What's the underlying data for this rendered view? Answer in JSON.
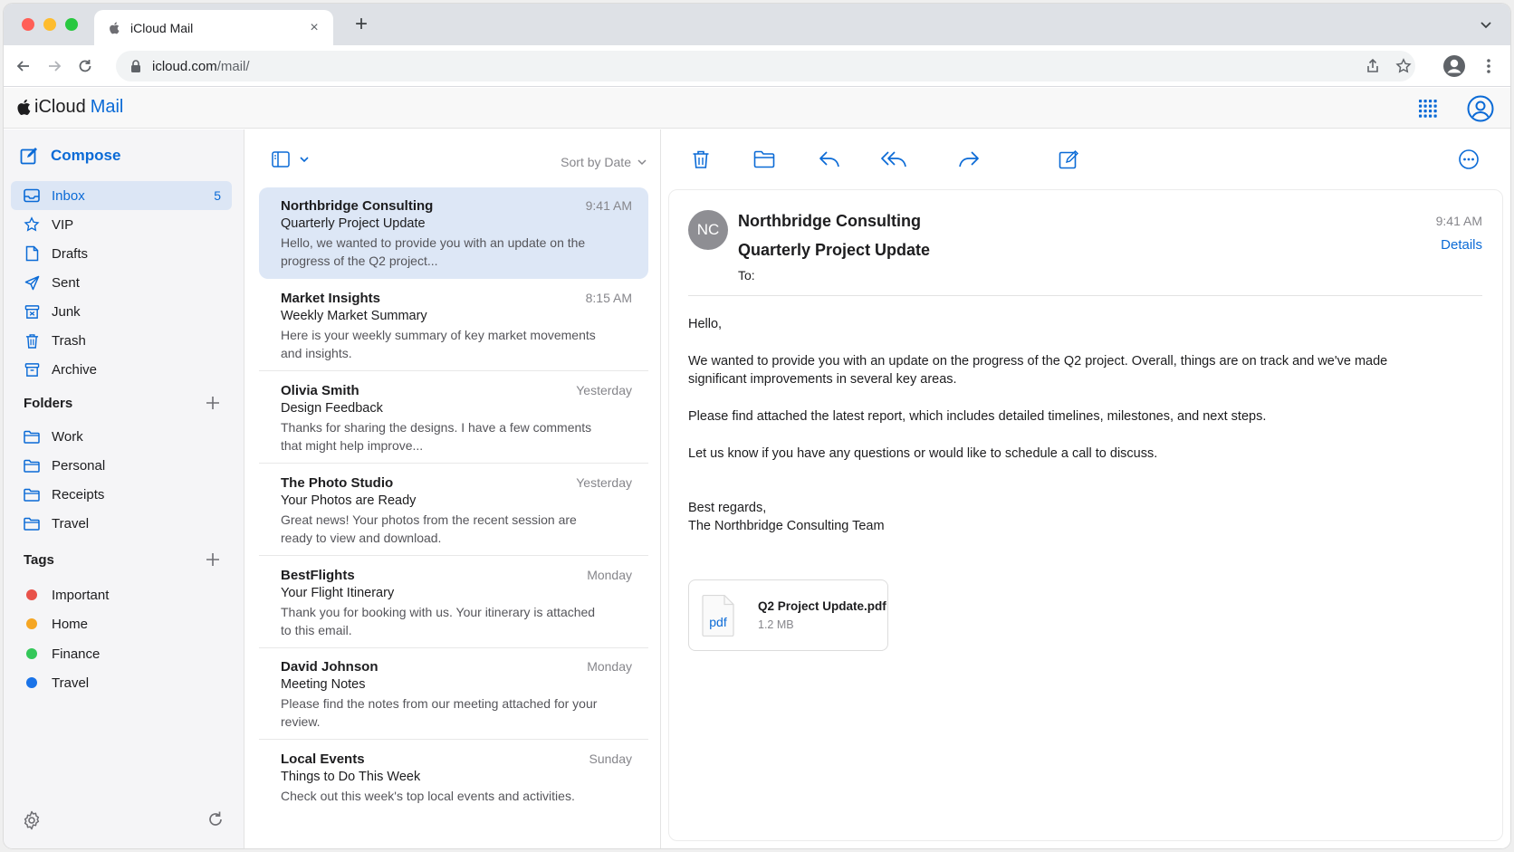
{
  "browser": {
    "tab_title": "iCloud Mail",
    "tab_close": "×",
    "new_tab": "+",
    "url_host": "icloud.com",
    "url_path": "/mail/"
  },
  "app": {
    "brand_icloud": "iCloud",
    "brand_mail": "Mail"
  },
  "sidebar": {
    "compose_label": "Compose",
    "mailboxes": [
      {
        "label": "Inbox",
        "count": "5",
        "icon": "inbox-icon"
      },
      {
        "label": "VIP",
        "icon": "star-icon"
      },
      {
        "label": "Drafts",
        "icon": "draft-icon"
      },
      {
        "label": "Sent",
        "icon": "sent-icon"
      },
      {
        "label": "Junk",
        "icon": "junk-icon"
      },
      {
        "label": "Trash",
        "icon": "trash-icon"
      },
      {
        "label": "Archive",
        "icon": "archive-icon"
      }
    ],
    "folders_heading": "Folders",
    "folders": [
      {
        "label": "Work"
      },
      {
        "label": "Personal"
      },
      {
        "label": "Receipts"
      },
      {
        "label": "Travel"
      }
    ],
    "tags_heading": "Tags",
    "tags": [
      {
        "label": "Important",
        "color": "#e8524a"
      },
      {
        "label": "Home",
        "color": "#f5a623"
      },
      {
        "label": "Finance",
        "color": "#34c759"
      },
      {
        "label": "Travel",
        "color": "#1a73e8"
      }
    ]
  },
  "list": {
    "sort_label": "Sort by Date",
    "messages": [
      {
        "sender": "Northbridge Consulting",
        "time": "9:41 AM",
        "subject": "Quarterly Project Update",
        "preview": "Hello, we wanted to provide you with an update on the progress of the Q2 project..."
      },
      {
        "sender": "Market Insights",
        "time": "8:15 AM",
        "subject": "Weekly Market Summary",
        "preview": "Here is your weekly summary of key market movements and insights."
      },
      {
        "sender": "Olivia Smith",
        "time": "Yesterday",
        "subject": "Design Feedback",
        "preview": "Thanks for sharing the designs. I have a few comments that might help improve..."
      },
      {
        "sender": "The Photo Studio",
        "time": "Yesterday",
        "subject": "Your Photos are Ready",
        "preview": "Great news! Your photos from the recent session are ready to view and download."
      },
      {
        "sender": "BestFlights",
        "time": "Monday",
        "subject": "Your Flight Itinerary",
        "preview": "Thank you for booking with us. Your itinerary is attached to this email."
      },
      {
        "sender": "David Johnson",
        "time": "Monday",
        "subject": "Meeting Notes",
        "preview": "Please find the notes from our meeting attached for your review."
      },
      {
        "sender": "Local Events",
        "time": "Sunday",
        "subject": "Things to Do This Week",
        "preview": "Check out this week's top local events and activities."
      }
    ]
  },
  "reader": {
    "avatar_initials": "NC",
    "sender": "Northbridge Consulting",
    "subject": "Quarterly Project Update",
    "to_label": "To:",
    "time": "9:41 AM",
    "details_label": "Details",
    "body": {
      "greeting": "Hello,",
      "p1": "We wanted to provide you with an update on the progress of the Q2 project. Overall, things are on track and we've made significant improvements in several key areas.",
      "p2": "Please find attached the latest report, which includes detailed timelines, milestones, and next steps.",
      "p3": "Let us know if you have any questions or would like to schedule a call to discuss.",
      "signoff": "Best regards,",
      "signature": "The Northbridge Consulting Team"
    },
    "attachment": {
      "type_label": "pdf",
      "name": "Q2 Project Update.pdf",
      "size": "1.2 MB"
    }
  },
  "colors": {
    "accent": "#0a6ad6",
    "selected_row": "#dde7f6"
  }
}
